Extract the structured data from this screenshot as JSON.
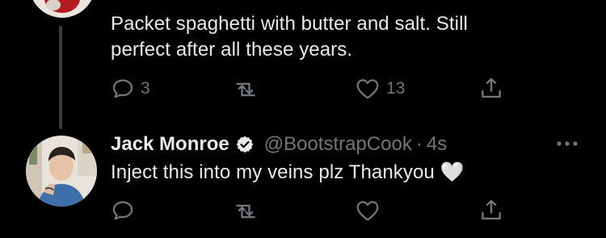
{
  "parent_tweet": {
    "text": "Packet spaghetti with butter and salt. Still\nperfect after all these years.",
    "reply_count": "3",
    "like_count": "13"
  },
  "reply_tweet": {
    "display_name": "Jack Monroe",
    "handle": "@BootstrapCook",
    "separator": "·",
    "time": "4s",
    "text": "Inject this into my veins plz Thankyou",
    "emoji": "🤍"
  },
  "colors": {
    "background": "#000000",
    "text": "#e7e9ea",
    "muted": "#71767b",
    "thread_line": "#3a3a3a"
  },
  "icons": [
    "reply-icon",
    "retweet-icon",
    "like-icon",
    "share-icon",
    "verified-badge-icon",
    "more-options-icon"
  ]
}
